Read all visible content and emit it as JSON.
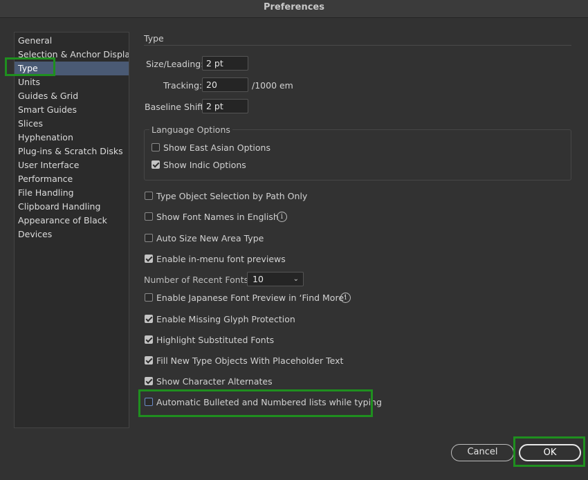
{
  "window": {
    "title": "Preferences"
  },
  "sidebar": {
    "items": [
      {
        "label": "General"
      },
      {
        "label": "Selection & Anchor Display"
      },
      {
        "label": "Type",
        "selected": true
      },
      {
        "label": "Units"
      },
      {
        "label": "Guides & Grid"
      },
      {
        "label": "Smart Guides"
      },
      {
        "label": "Slices"
      },
      {
        "label": "Hyphenation"
      },
      {
        "label": "Plug-ins & Scratch Disks"
      },
      {
        "label": "User Interface"
      },
      {
        "label": "Performance"
      },
      {
        "label": "File Handling"
      },
      {
        "label": "Clipboard Handling"
      },
      {
        "label": "Appearance of Black"
      },
      {
        "label": "Devices"
      }
    ]
  },
  "type_section": {
    "title": "Type",
    "size_leading": {
      "label": "Size/Leading:",
      "value": "2 pt"
    },
    "tracking": {
      "label": "Tracking:",
      "value": "20",
      "unit": "/1000 em"
    },
    "baseline_shift": {
      "label": "Baseline Shift:",
      "value": "2 pt"
    }
  },
  "language_options": {
    "title": "Language Options",
    "east_asian": {
      "label": "Show East Asian Options",
      "checked": false
    },
    "indic": {
      "label": "Show Indic Options",
      "checked": true
    }
  },
  "options": {
    "type_object_selection": {
      "label": "Type Object Selection by Path Only",
      "checked": false
    },
    "font_names_english": {
      "label": "Show Font Names in English",
      "checked": false
    },
    "auto_size_area": {
      "label": "Auto Size New Area Type",
      "checked": false
    },
    "inmenu_previews": {
      "label": "Enable in-menu font previews",
      "checked": true
    },
    "recent_fonts": {
      "label": "Number of Recent Fonts:",
      "value": "10"
    },
    "japanese_preview": {
      "label": "Enable Japanese Font Preview in ‘Find More’",
      "checked": false
    },
    "missing_glyph": {
      "label": "Enable Missing Glyph Protection",
      "checked": true
    },
    "highlight_substituted": {
      "label": "Highlight Substituted Fonts",
      "checked": true
    },
    "placeholder_text": {
      "label": "Fill New Type Objects With Placeholder Text",
      "checked": true
    },
    "character_alternates": {
      "label": "Show Character Alternates",
      "checked": true
    },
    "auto_bullets": {
      "label": "Automatic Bulleted and Numbered lists while typing",
      "checked": false
    }
  },
  "buttons": {
    "cancel": "Cancel",
    "ok": "OK"
  },
  "icons": {
    "info": "info-icon",
    "chevron": "chevron-down-icon",
    "check": "checkmark-icon"
  },
  "colors": {
    "selected_row": "#4a5a74",
    "highlight": "#1f8f1f",
    "background": "#323232"
  }
}
